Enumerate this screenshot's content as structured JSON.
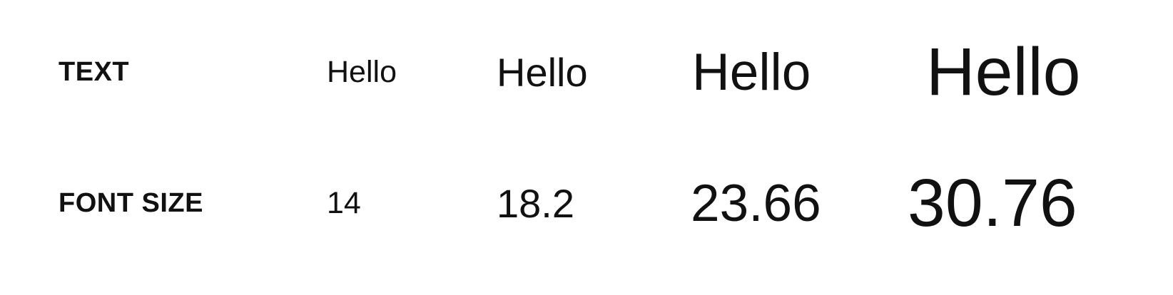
{
  "rows": {
    "text": {
      "label": "TEXT",
      "samples": [
        "Hello",
        "Hello",
        "Hello",
        "Hello"
      ]
    },
    "font_size": {
      "label": "FONT SIZE",
      "values": [
        "14",
        "18.2",
        "23.66",
        "30.76"
      ]
    }
  }
}
